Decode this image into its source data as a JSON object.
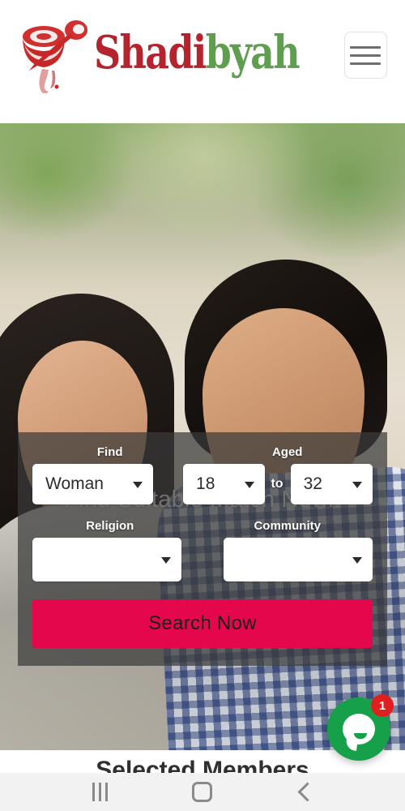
{
  "header": {
    "brand_name_part1": "Shadi",
    "brand_name_part2": "byah",
    "brand_color_red": "#b4242f",
    "brand_color_green": "#5f9e4e",
    "menu_icon": "hamburger-icon"
  },
  "hero": {
    "title": "Find Suitable Match Now..",
    "image_description": "smiling couple outdoors"
  },
  "search_form": {
    "labels": {
      "find": "Find",
      "aged": "Aged",
      "religion": "Religion",
      "community": "Community"
    },
    "find_value": "Woman",
    "age_from_value": "18",
    "age_to_value": "32",
    "age_separator": "to",
    "religion_value": "",
    "community_value": "",
    "submit_label": "Search Now",
    "submit_color": "#e4074c"
  },
  "next_section": {
    "heading": "Selected Members"
  },
  "chat": {
    "icon": "chat-bubble-icon",
    "badge_count": "1",
    "button_color": "#17a04a",
    "badge_color": "#e02020"
  },
  "nav_bar": {
    "recents_icon": "recents-icon",
    "home_icon": "home-icon",
    "back_icon": "back-icon"
  }
}
